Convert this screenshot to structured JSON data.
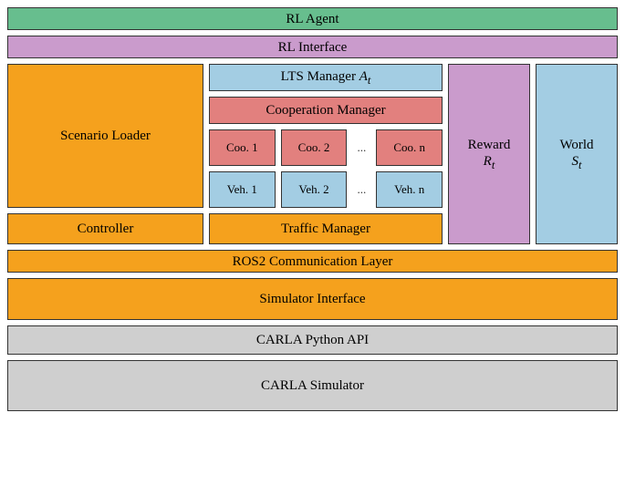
{
  "rl_agent": "RL Agent",
  "rl_interface": "RL Interface",
  "scenario_loader": "Scenario Loader",
  "controller": "Controller",
  "lts_manager": {
    "label": "LTS Manager ",
    "var": "A",
    "sub": "t"
  },
  "coop_manager": "Cooperation Manager",
  "coo": {
    "c1": "Coo. 1",
    "c2": "Coo. 2",
    "cn": "Coo. n"
  },
  "veh": {
    "v1": "Veh. 1",
    "v2": "Veh. 2",
    "vn": "Veh. n"
  },
  "ellipsis": "...",
  "traffic_manager": "Traffic Manager",
  "reward": {
    "label": "Reward",
    "var": "R",
    "sub": "t"
  },
  "world": {
    "label": "World",
    "var": "S",
    "sub": "t"
  },
  "ros2": "ROS2 Communication Layer",
  "sim_interface": "Simulator Interface",
  "carla_api": "CARLA Python API",
  "carla_sim": "CARLA Simulator"
}
